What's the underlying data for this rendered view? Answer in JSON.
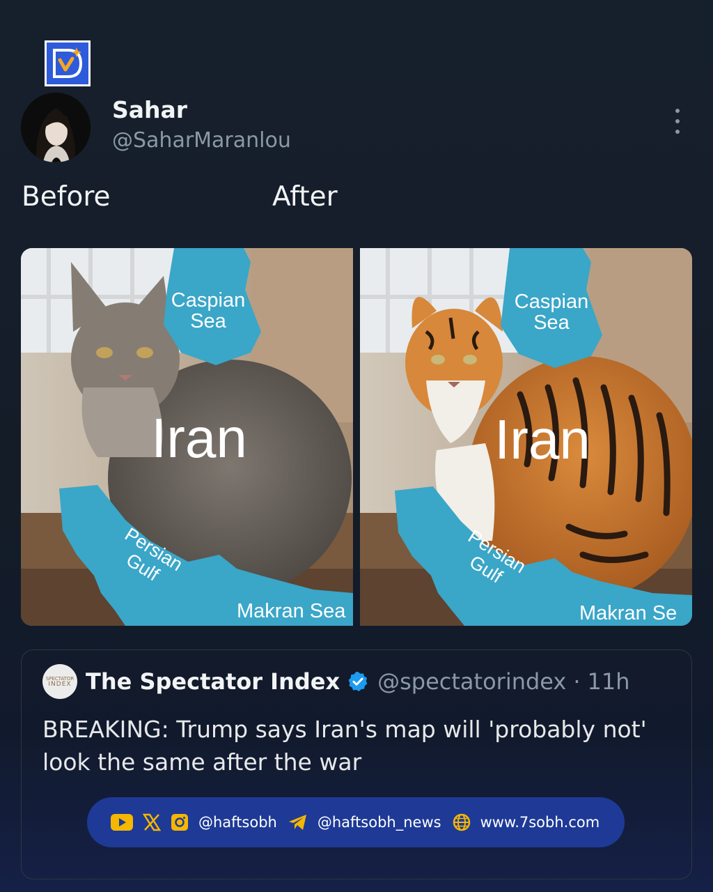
{
  "post": {
    "author_name": "Sahar",
    "author_handle": "@SaharMaranlou",
    "caption_left": "Before",
    "caption_right": "After"
  },
  "images": {
    "before": {
      "subject": "cat",
      "labels": {
        "caspian": [
          "Caspian",
          "Sea"
        ],
        "country": "Iran",
        "gulf": [
          "Persian",
          "Gulf"
        ],
        "makran": "Makran Sea"
      }
    },
    "after": {
      "subject": "tiger",
      "labels": {
        "caspian": [
          "Caspian",
          "Sea"
        ],
        "country": "Iran",
        "gulf": [
          "Persian",
          "Gulf"
        ],
        "makran": "Makran Se"
      }
    }
  },
  "quote": {
    "source_name": "The Spectator Index",
    "source_avatar_text": [
      "SPECTATOR",
      "INDEX"
    ],
    "source_handle": "@spectatorindex",
    "separator": "·",
    "time": "11h",
    "text": "BREAKING: Trump says Iran's map will 'probably not' look the same after the war"
  },
  "social_bar": {
    "handle_1": "@haftsobh",
    "handle_2": "@haftsobh_news",
    "website": "www.7sobh.com",
    "icons": [
      "youtube-icon",
      "x-icon",
      "instagram-icon",
      "telegram-icon",
      "globe-icon"
    ]
  },
  "colors": {
    "background": "#141c28",
    "water": "#3aa6c8",
    "bar": "#1e3a96",
    "verified": "#1d9bf0"
  }
}
